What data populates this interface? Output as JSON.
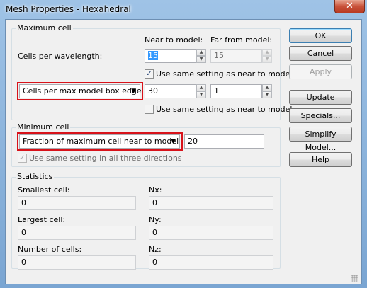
{
  "window": {
    "title": "Mesh Properties - Hexahedral",
    "close_glyph": "✕"
  },
  "max_cell": {
    "group_label": "Maximum cell",
    "col_near": "Near to model:",
    "col_far": "Far from model:",
    "cells_per_wavelength_label": "Cells per wavelength:",
    "near_value": "15",
    "far_value": "15",
    "same_setting_1": "Use same setting as near to model",
    "same_setting_1_checked": true,
    "dropdown_value": "Cells per max model box edge",
    "box_near_value": "30",
    "box_far_value": "1",
    "same_setting_2": "Use same setting as near to model",
    "same_setting_2_checked": false
  },
  "min_cell": {
    "group_label": "Minimum cell",
    "dropdown_value": "Fraction of maximum cell near to model",
    "value": "20",
    "all_directions": "Use same setting in all three directions",
    "all_directions_checked": true
  },
  "statistics": {
    "group_label": "Statistics",
    "smallest_label": "Smallest cell:",
    "smallest_value": "0",
    "largest_label": "Largest cell:",
    "largest_value": "0",
    "num_cells_label": "Number of cells:",
    "num_cells_value": "0",
    "nx_label": "Nx:",
    "nx_value": "0",
    "ny_label": "Ny:",
    "ny_value": "0",
    "nz_label": "Nz:",
    "nz_value": "0"
  },
  "buttons": {
    "ok": "OK",
    "cancel": "Cancel",
    "apply": "Apply",
    "update": "Update",
    "specials": "Specials...",
    "simplify": "Simplify Model...",
    "help": "Help"
  },
  "colors": {
    "highlight_border": "#d8121a",
    "title_bar": "#9fc3e6"
  }
}
